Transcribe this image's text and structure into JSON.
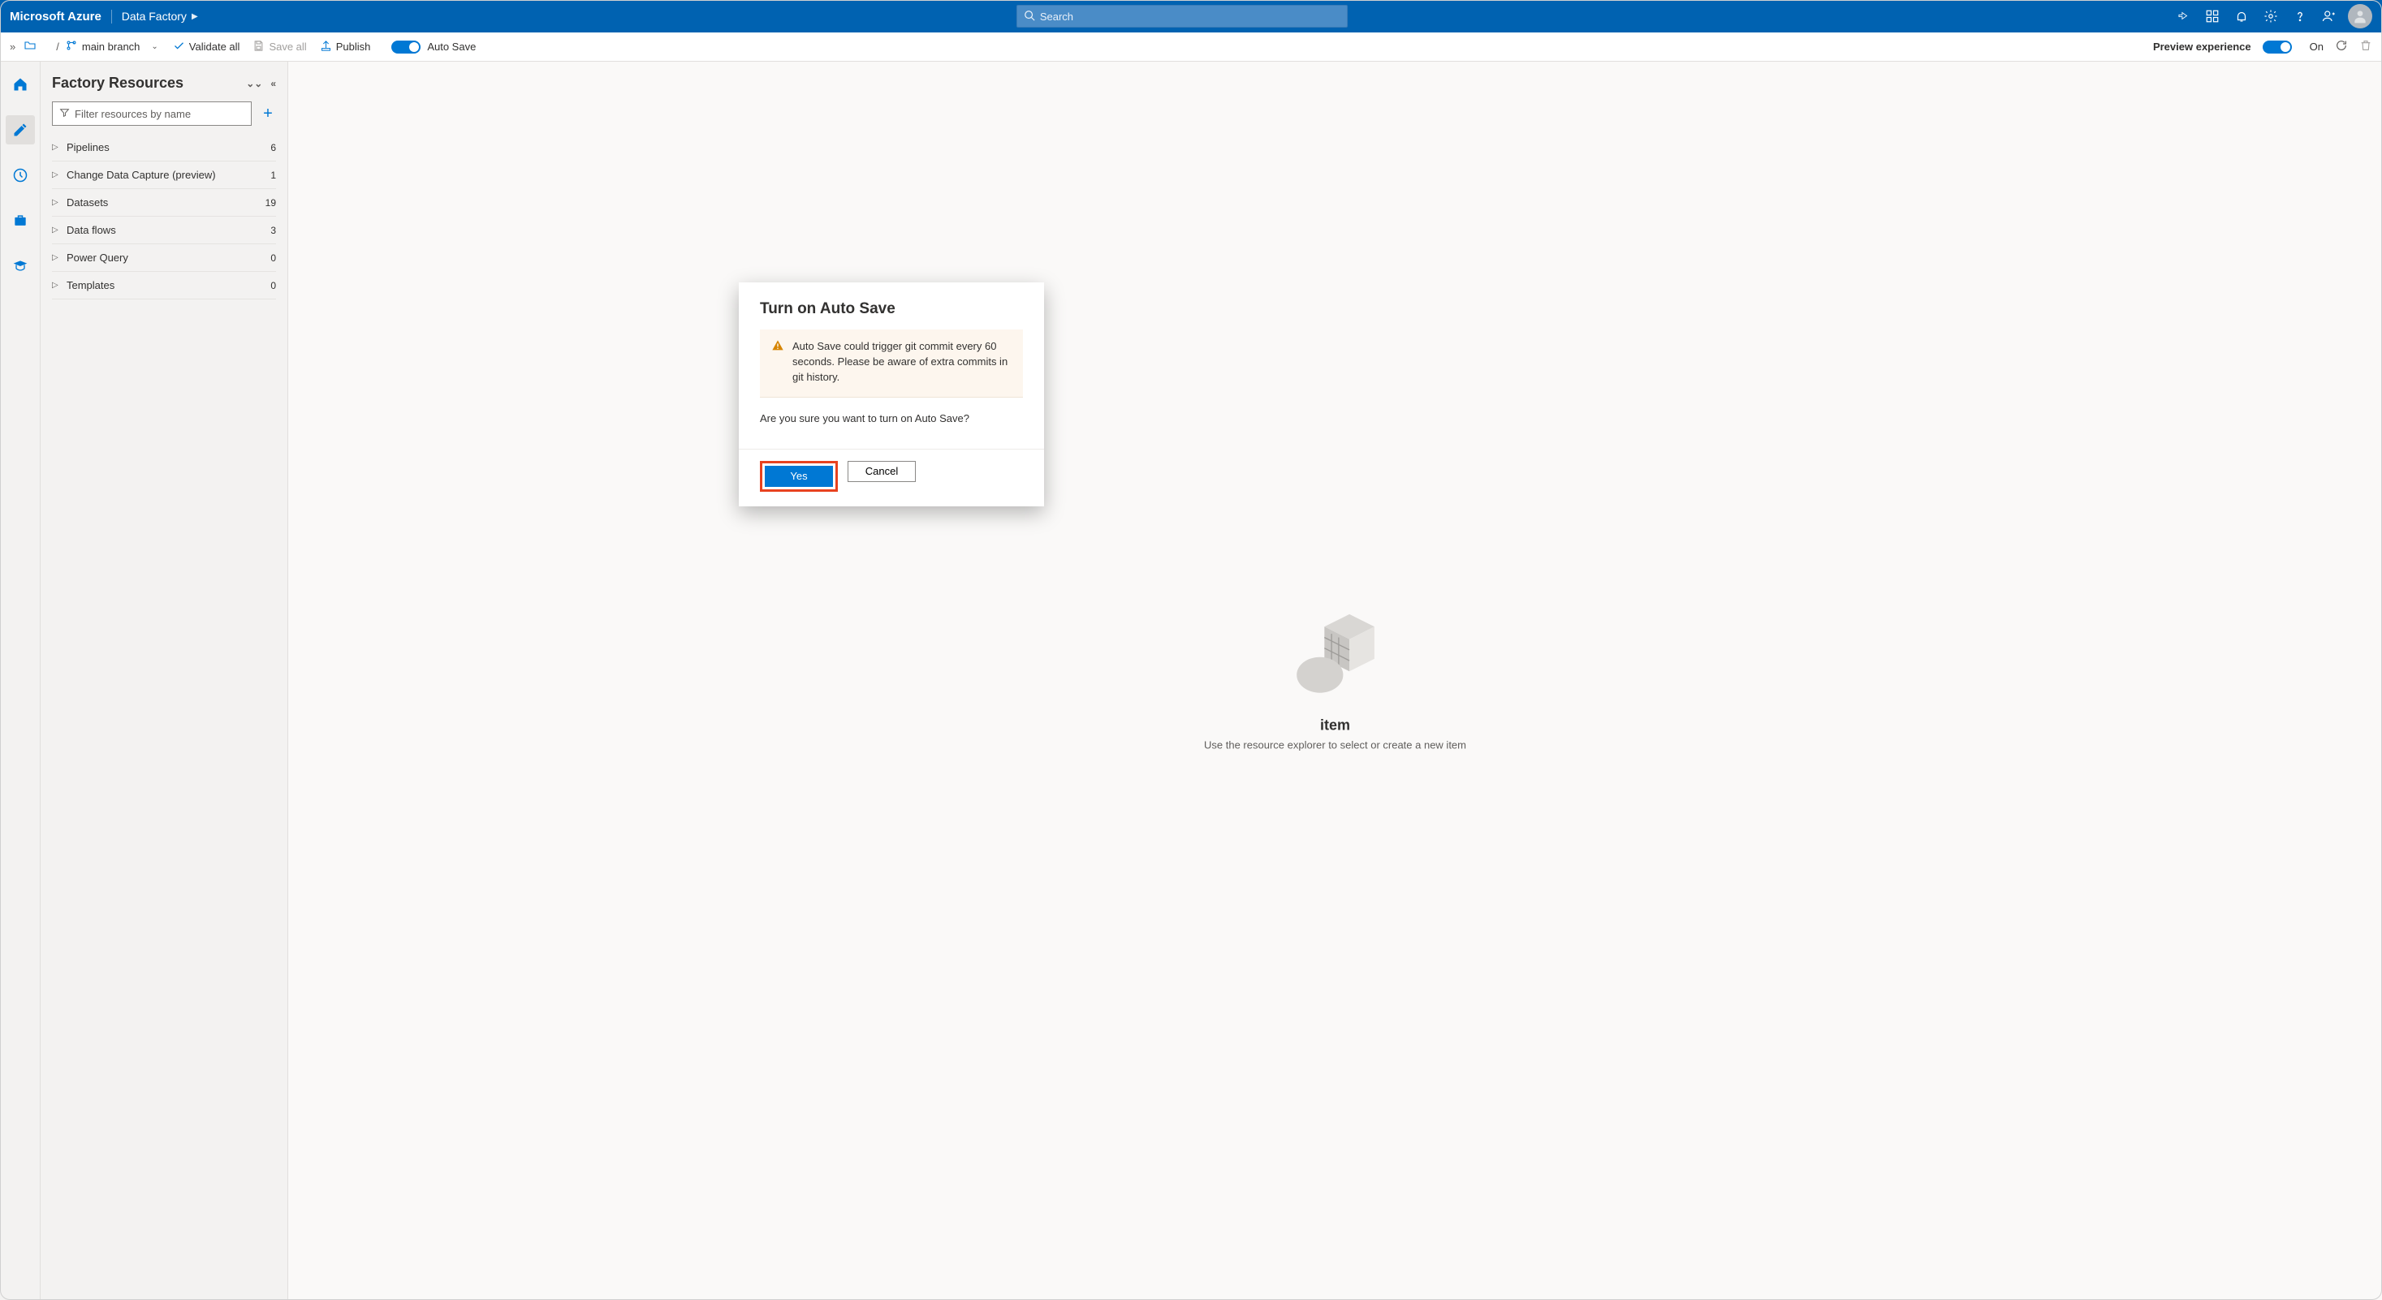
{
  "topbar": {
    "brand": "Microsoft Azure",
    "service": "Data Factory",
    "search_placeholder": "Search"
  },
  "toolbar": {
    "branch_label": "main branch",
    "validate_label": "Validate all",
    "save_label": "Save all",
    "publish_label": "Publish",
    "autosave_label": "Auto Save",
    "preview_label": "Preview experience",
    "preview_state": "On"
  },
  "sidebar": {
    "heading": "Factory Resources",
    "filter_placeholder": "Filter resources by name",
    "items": [
      {
        "label": "Pipelines",
        "count": "6"
      },
      {
        "label": "Change Data Capture (preview)",
        "count": "1"
      },
      {
        "label": "Datasets",
        "count": "19"
      },
      {
        "label": "Data flows",
        "count": "3"
      },
      {
        "label": "Power Query",
        "count": "0"
      },
      {
        "label": "Templates",
        "count": "0"
      }
    ]
  },
  "empty": {
    "title_suffix": "item",
    "subtitle": "Use the resource explorer to select or create a new item"
  },
  "modal": {
    "title": "Turn on Auto Save",
    "warning": "Auto Save could trigger git commit every 60 seconds. Please be aware of extra commits in git history.",
    "question": "Are you sure you want to turn on Auto Save?",
    "yes_label": "Yes",
    "cancel_label": "Cancel"
  }
}
